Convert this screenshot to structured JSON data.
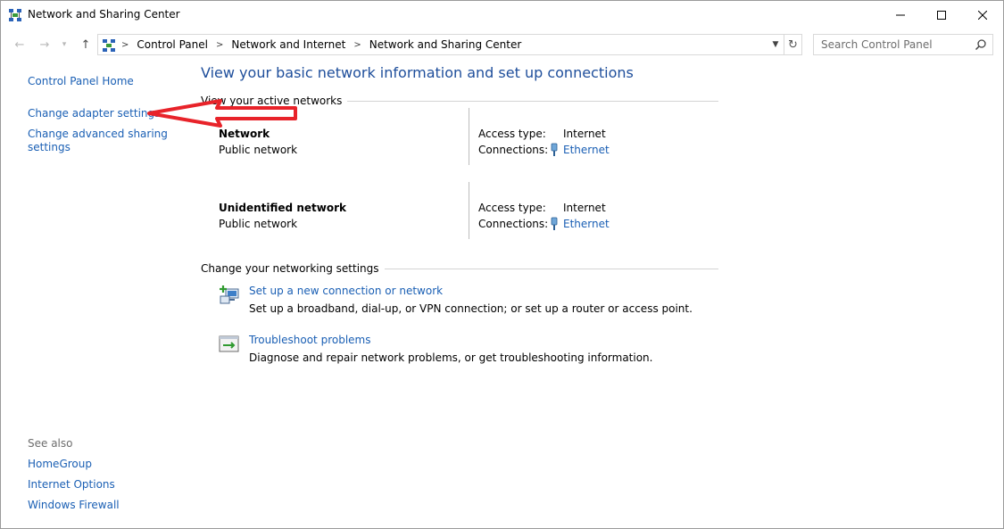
{
  "window": {
    "title": "Network and Sharing Center"
  },
  "address": {
    "crumbs": [
      "Control Panel",
      "Network and Internet",
      "Network and Sharing Center"
    ],
    "search_placeholder": "Search Control Panel"
  },
  "left_pane": {
    "home": "Control Panel Home",
    "change_adapter": "Change adapter settings",
    "change_sharing_line1": "Change advanced sharing",
    "change_sharing_line2": "settings",
    "see_also": "See also",
    "homegroup": "HomeGroup",
    "internet_options": "Internet Options",
    "windows_firewall": "Windows Firewall"
  },
  "main": {
    "title": "View your basic network information and set up connections",
    "active_networks_label": "View your active networks",
    "networks": [
      {
        "name": "Network",
        "type": "Public network",
        "access_label": "Access type:",
        "access_value": "Internet",
        "connections_label": "Connections:",
        "connection": "Ethernet"
      },
      {
        "name": "Unidentified network",
        "type": "Public network",
        "access_label": "Access type:",
        "access_value": "Internet",
        "connections_label": "Connections:",
        "connection": "Ethernet"
      }
    ],
    "change_settings_label": "Change your networking settings",
    "tasks": [
      {
        "link": "Set up a new connection or network",
        "desc": "Set up a broadband, dial-up, or VPN connection; or set up a router or access point."
      },
      {
        "link": "Troubleshoot problems",
        "desc": "Diagnose and repair network problems, or get troubleshooting information."
      }
    ]
  },
  "colors": {
    "link": "#1a5fb4",
    "title_blue": "#1e4e9b",
    "annotation": "#e8232a"
  }
}
